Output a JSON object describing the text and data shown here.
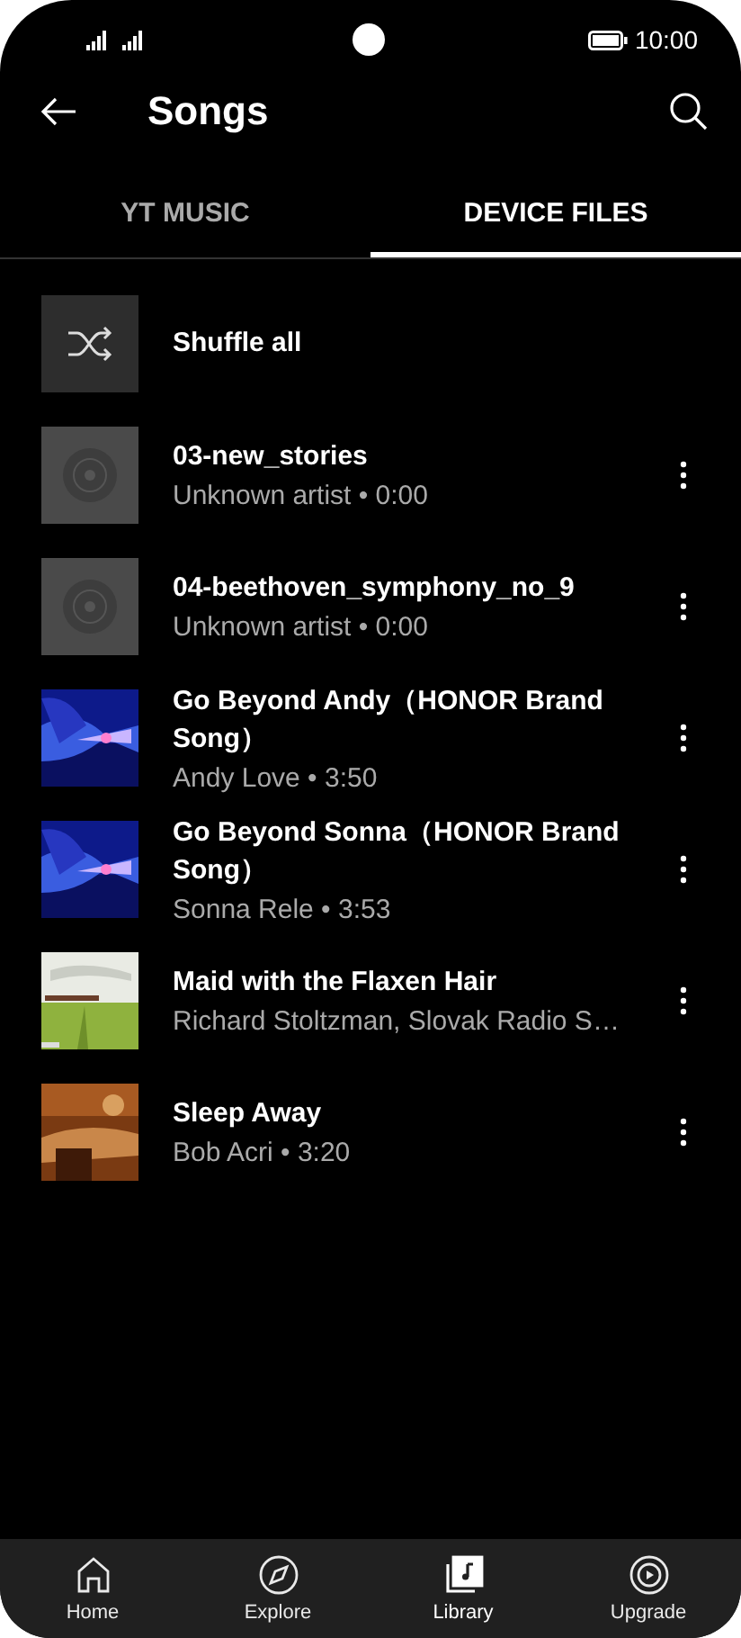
{
  "status_bar": {
    "time": "10:00"
  },
  "header": {
    "title": "Songs"
  },
  "tabs": [
    {
      "label": "YT MUSIC",
      "selected": false
    },
    {
      "label": "DEVICE FILES",
      "selected": true
    }
  ],
  "shuffle": {
    "label": "Shuffle all"
  },
  "songs": [
    {
      "title": "03-new_stories",
      "subtitle": "Unknown artist • 0:00",
      "kind": "placeholder"
    },
    {
      "title": "04-beethoven_symphony_no_9",
      "subtitle": "Unknown artist • 0:00",
      "kind": "placeholder"
    },
    {
      "title": "Go Beyond Andy（HONOR Brand Song）",
      "subtitle": "Andy Love • 3:50",
      "kind": "picture"
    },
    {
      "title": "Go Beyond Sonna（HONOR Brand Song）",
      "subtitle": "Sonna Rele • 3:53",
      "kind": "picture"
    },
    {
      "title": "Maid with the Flaxen Hair",
      "subtitle": "Richard Stoltzman, Slovak Radio S…",
      "kind": "picture"
    },
    {
      "title": "Sleep Away",
      "subtitle": "Bob Acri • 3:20",
      "kind": "picture"
    }
  ],
  "nav": [
    {
      "label": "Home",
      "selected": false
    },
    {
      "label": "Explore",
      "selected": false
    },
    {
      "label": "Library",
      "selected": true
    },
    {
      "label": "Upgrade",
      "selected": false
    }
  ]
}
